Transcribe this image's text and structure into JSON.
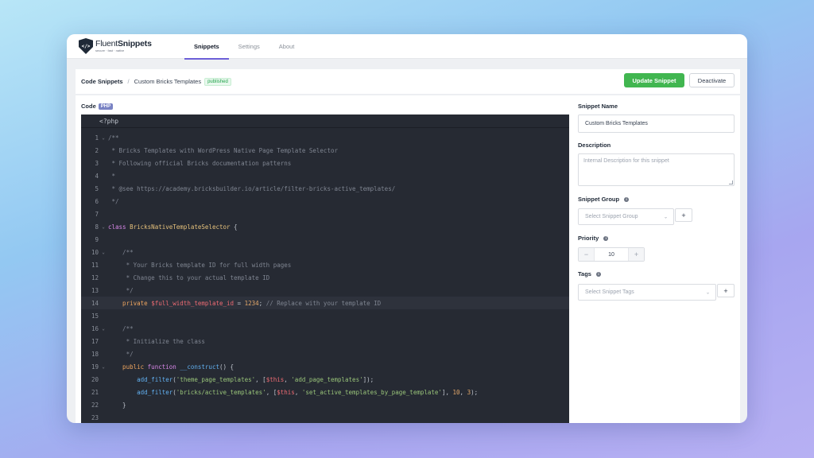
{
  "app": {
    "logo_text_regular": "Fluent",
    "logo_text_bold": "Snippets",
    "logo_tagline": "secure · fast · native",
    "logo_icon": "</>",
    "nav_tabs": [
      {
        "label": "Snippets",
        "active": true
      },
      {
        "label": "Settings",
        "active": false
      },
      {
        "label": "About",
        "active": false
      }
    ]
  },
  "header": {
    "breadcrumb_root": "Code Snippets",
    "breadcrumb_sep": "/",
    "snippet_title": "Custom Bricks Templates",
    "status_badge": "published",
    "update_button": "Update Snippet",
    "deactivate_button": "Deactivate"
  },
  "code_section": {
    "label": "Code",
    "language_badge": "PHP",
    "opening_tag": "<?php",
    "lines": [
      {
        "n": "1",
        "fold": true,
        "tokens": [
          [
            "c-cmt",
            "/**"
          ]
        ]
      },
      {
        "n": "2",
        "fold": false,
        "tokens": [
          [
            "c-cmt",
            " * Bricks Templates with WordPress Native Page Template Selector"
          ]
        ]
      },
      {
        "n": "3",
        "fold": false,
        "tokens": [
          [
            "c-cmt",
            " * Following official Bricks documentation patterns"
          ]
        ]
      },
      {
        "n": "4",
        "fold": false,
        "tokens": [
          [
            "c-cmt",
            " *"
          ]
        ]
      },
      {
        "n": "5",
        "fold": false,
        "tokens": [
          [
            "c-cmt",
            " * @see https://academy.bricksbuilder.io/article/filter-bricks-active_templates/"
          ]
        ]
      },
      {
        "n": "6",
        "fold": false,
        "tokens": [
          [
            "c-cmt",
            " */"
          ]
        ]
      },
      {
        "n": "7",
        "fold": false,
        "tokens": []
      },
      {
        "n": "8",
        "fold": true,
        "tokens": [
          [
            "c-kw",
            "class "
          ],
          [
            "c-cls",
            "BricksNativeTemplateSelector"
          ],
          [
            "c-pl",
            " {"
          ]
        ]
      },
      {
        "n": "9",
        "fold": false,
        "tokens": []
      },
      {
        "n": "10",
        "fold": true,
        "tokens": [
          [
            "c-cmt",
            "    /**"
          ]
        ]
      },
      {
        "n": "11",
        "fold": false,
        "tokens": [
          [
            "c-cmt",
            "     * Your Bricks template ID for full width pages"
          ]
        ]
      },
      {
        "n": "12",
        "fold": false,
        "tokens": [
          [
            "c-cmt",
            "     * Change this to your actual template ID"
          ]
        ]
      },
      {
        "n": "13",
        "fold": false,
        "tokens": [
          [
            "c-cmt",
            "     */"
          ]
        ]
      },
      {
        "n": "14",
        "fold": false,
        "hl": true,
        "tokens": [
          [
            "c-kw2",
            "    private "
          ],
          [
            "c-var",
            "$full_width_template_id"
          ],
          [
            "c-pl",
            " = "
          ],
          [
            "c-num",
            "1234"
          ],
          [
            "c-pl",
            "; "
          ],
          [
            "c-cmt",
            "// Replace with your template ID"
          ]
        ]
      },
      {
        "n": "15",
        "fold": false,
        "tokens": []
      },
      {
        "n": "16",
        "fold": true,
        "tokens": [
          [
            "c-cmt",
            "    /**"
          ]
        ]
      },
      {
        "n": "17",
        "fold": false,
        "tokens": [
          [
            "c-cmt",
            "     * Initialize the class"
          ]
        ]
      },
      {
        "n": "18",
        "fold": false,
        "tokens": [
          [
            "c-cmt",
            "     */"
          ]
        ]
      },
      {
        "n": "19",
        "fold": true,
        "tokens": [
          [
            "c-kw2",
            "    public "
          ],
          [
            "c-kw",
            "function "
          ],
          [
            "c-fn",
            "__construct"
          ],
          [
            "c-pl",
            "() {"
          ]
        ]
      },
      {
        "n": "20",
        "fold": false,
        "tokens": [
          [
            "c-fn",
            "        add_filter"
          ],
          [
            "c-pl",
            "("
          ],
          [
            "c-str",
            "'theme_page_templates'"
          ],
          [
            "c-pl",
            ", ["
          ],
          [
            "c-var",
            "$this"
          ],
          [
            "c-pl",
            ", "
          ],
          [
            "c-str",
            "'add_page_templates'"
          ],
          [
            "c-pl",
            "]);"
          ]
        ]
      },
      {
        "n": "21",
        "fold": false,
        "tokens": [
          [
            "c-fn",
            "        add_filter"
          ],
          [
            "c-pl",
            "("
          ],
          [
            "c-str",
            "'bricks/active_templates'"
          ],
          [
            "c-pl",
            ", ["
          ],
          [
            "c-var",
            "$this"
          ],
          [
            "c-pl",
            ", "
          ],
          [
            "c-str",
            "'set_active_templates_by_page_template'"
          ],
          [
            "c-pl",
            "], "
          ],
          [
            "c-num",
            "10"
          ],
          [
            "c-pl",
            ", "
          ],
          [
            "c-num",
            "3"
          ],
          [
            "c-pl",
            ");"
          ]
        ]
      },
      {
        "n": "22",
        "fold": false,
        "tokens": [
          [
            "c-pl",
            "    }"
          ]
        ]
      },
      {
        "n": "23",
        "fold": false,
        "tokens": []
      }
    ]
  },
  "form": {
    "name_label": "Snippet Name",
    "name_value": "Custom Bricks Templates",
    "description_label": "Description",
    "description_placeholder": "Internal Description for this snippet",
    "group_label": "Snippet Group",
    "group_placeholder": "Select Snippet Group",
    "priority_label": "Priority",
    "priority_value": "10",
    "priority_minus": "−",
    "priority_plus": "+",
    "tags_label": "Tags",
    "tags_placeholder": "Select Snippet Tags",
    "add_label": "+",
    "info_glyph": "i",
    "chevron_glyph": "⌄"
  },
  "colors": {
    "accent": "#6d5fd8",
    "update_button": "#41b650",
    "published_badge": "#22a34a",
    "editor_bg": "#262a33"
  }
}
